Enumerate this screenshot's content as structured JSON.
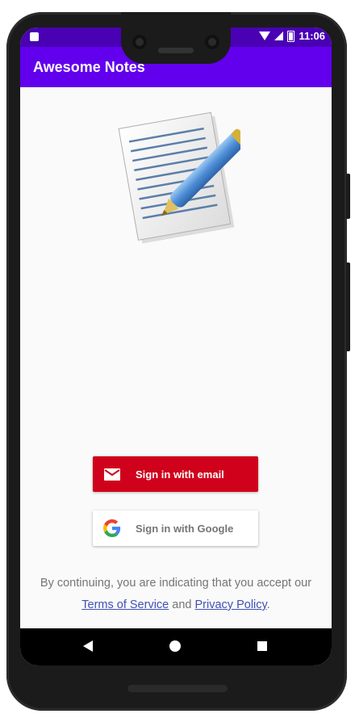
{
  "status_bar": {
    "time": "11:06",
    "icons": [
      "sd-card-icon",
      "wifi-icon",
      "cell-signal-icon",
      "battery-charging-icon"
    ]
  },
  "app_bar": {
    "title": "Awesome Notes"
  },
  "logo": {
    "icon": "notepad-pencil-icon"
  },
  "buttons": {
    "email": {
      "label": "Sign in with email",
      "icon": "mail-icon",
      "color": "#d0021b"
    },
    "google": {
      "label": "Sign in with Google",
      "icon": "google-icon",
      "color": "#ffffff"
    }
  },
  "terms": {
    "prefix": "By continuing, you are indicating that you accept our",
    "tos": "Terms of Service",
    "and": "and",
    "privacy": "Privacy Policy",
    "suffix": "."
  },
  "nav": {
    "icons": [
      "back-icon",
      "home-icon",
      "recents-icon"
    ]
  },
  "colors": {
    "primary": "#6200ee",
    "status_bar": "#4a00b3",
    "link": "#3f51b5"
  }
}
